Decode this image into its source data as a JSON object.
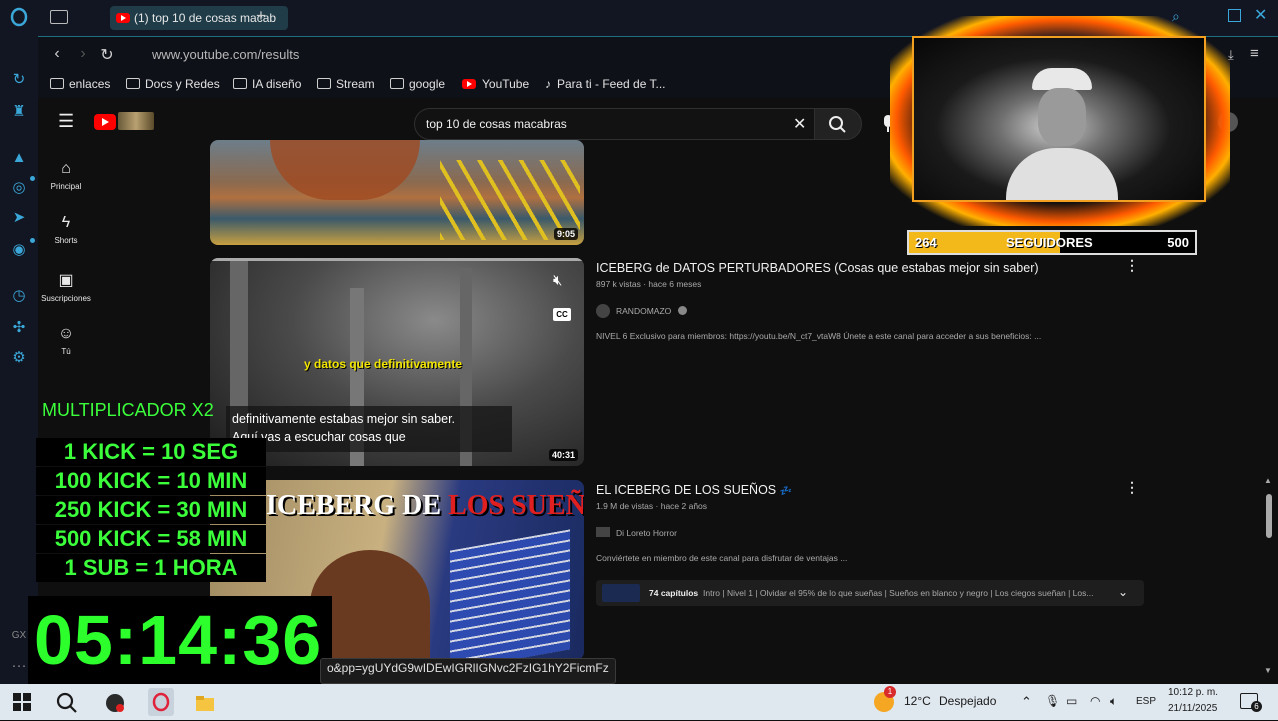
{
  "browser": {
    "tab_title": "(1) top 10 de cosas macab",
    "new_tab_label": "+",
    "url": "www.youtube.com/results",
    "bookmarks": [
      "enlaces",
      "Docs y Redes",
      "IA diseño",
      "Stream",
      "google",
      "YouTube",
      "Para ti - Feed de T..."
    ],
    "status_url": "o&pp=ygUYdG9wIDEwIGRlIGNvc2FzIG1hY2FicmFz"
  },
  "youtube": {
    "search_value": "top 10 de cosas macabras",
    "guide": [
      "Principal",
      "Shorts",
      "Suscripciones",
      "Tú"
    ],
    "videos": [
      {
        "duration": "9:05"
      },
      {
        "title": "ICEBERG de DATOS PERTURBADORES (Cosas que estabas mejor sin saber)",
        "meta": "897 k vistas · hace 6 meses",
        "channel": "RANDOMAZO",
        "description": "NIVEL 6 Exclusivo para miembros: https://youtu.be/N_ct7_vtaW8 Únete a este canal para acceder a sus beneficios: ...",
        "duration": "40:31",
        "caption_top": "y datos que definitivamente",
        "caption_line1": "definitivamente estabas mejor sin saber.",
        "caption_line2": "Aquí vas a escuchar cosas que",
        "cc_label": "CC"
      },
      {
        "title": "EL ICEBERG DE LOS SUEÑOS",
        "title_suffix": "💤",
        "meta": "1.9 M de vistas · hace 2 años",
        "channel": "Di Loreto Horror",
        "description": "Conviértete en miembro de este canal para disfrutar de ventajas ...",
        "thumb_text_a": "ICEBERG DE ",
        "thumb_text_b": "LOS SUEÑOS",
        "chapters_count": "74 capítulos",
        "chapters_text": "Intro | Nivel 1 | Olvidar el 95% de lo que sueñas | Sueños en blanco y negro | Los ciegos sueñan | Los..."
      }
    ]
  },
  "overlay": {
    "followers_current": "264",
    "followers_label": "SEGUIDORES",
    "followers_goal": "500",
    "followers_progress": 0.528,
    "multiplier": "MULTIPLICADOR X2",
    "kick_lines": [
      "1 KICK = 10 SEG",
      "100  KICK = 10 MIN",
      "250 KICK = 30 MIN",
      "500 KICK = 58 MIN",
      "1 SUB = 1 HORA"
    ],
    "timer": "05:14:36"
  },
  "taskbar": {
    "weather_temp": "12°C",
    "weather_text": "Despejado",
    "lang": "ESP",
    "time": "10:12 p. m.",
    "date": "21/11/2025",
    "notif_badge": "6",
    "weather_badge": "1"
  },
  "colors": {
    "accent_green": "#2dff2d",
    "youtube_red": "#ff0000",
    "progress_yellow": "#f3b81a",
    "opera_blue": "#3aa7d8"
  }
}
